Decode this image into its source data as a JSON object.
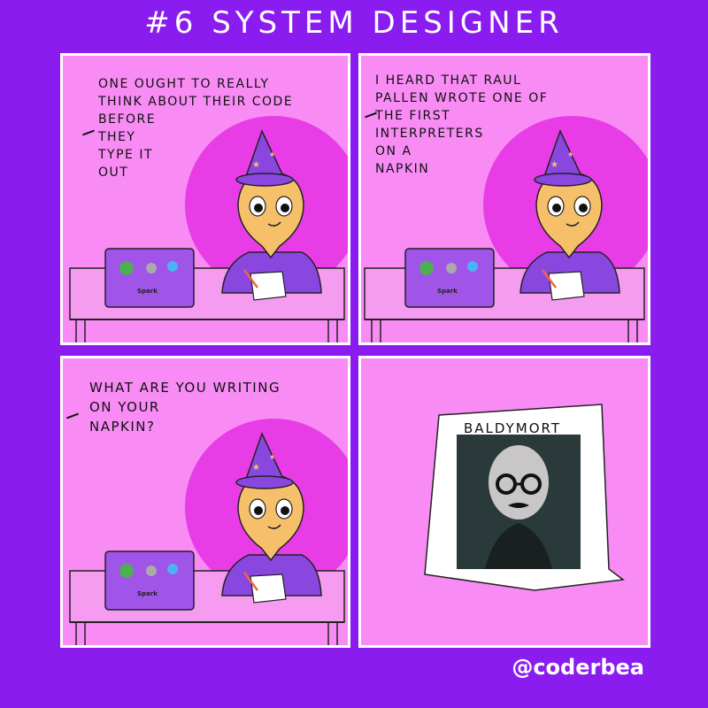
{
  "title": "#6 SYSTEM DESIGNER",
  "credit": "@coderbea",
  "panels": [
    {
      "lines": [
        "ONE OUGHT TO REALLY",
        "THINK ABOUT THEIR CODE",
        "BEFORE",
        "THEY",
        "TYPE IT",
        "OUT"
      ]
    },
    {
      "lines": [
        "I HEARD THAT RAUL",
        "PALLEN WROTE ONE OF",
        "THE FIRST",
        "INTERPRETERS",
        "ON A",
        "NAPKIN"
      ]
    },
    {
      "lines": [
        "WHAT ARE YOU WRITING",
        "ON YOUR",
        "NAPKIN?"
      ]
    }
  ],
  "poster": {
    "title": "BALDYMORT"
  },
  "laptop": {
    "sticker_label": "Spark"
  },
  "colors": {
    "background": "#8a1cf0",
    "panel": "#f88cf4",
    "halo": "#e83de6",
    "desk": "#f59cf1",
    "robe": "#8a47e0",
    "face": "#f6c06b",
    "laptop": "#a054e8"
  }
}
